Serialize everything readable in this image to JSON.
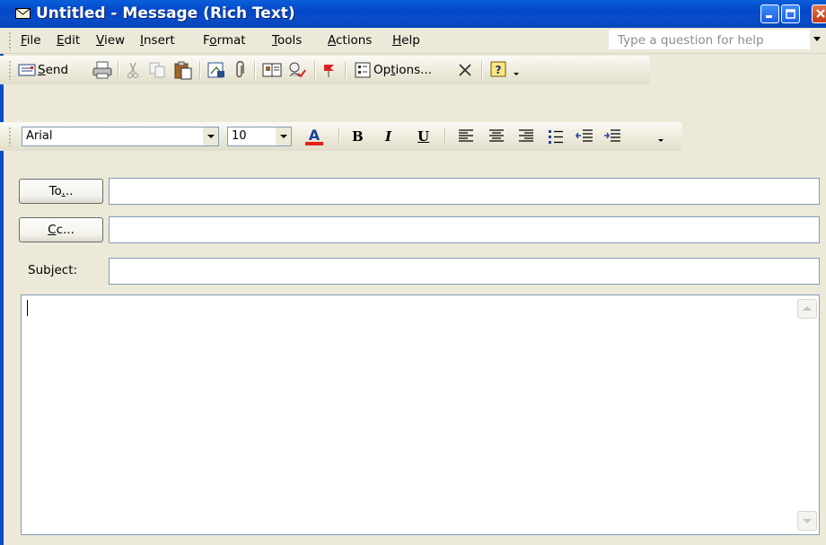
{
  "window": {
    "title": "Untitled - Message (Rich Text)",
    "title_bar_color": "#0A4CC8",
    "icons": [
      "envelope-icon",
      "minimize-icon",
      "maximize-icon",
      "close-icon"
    ]
  },
  "menu": {
    "items": [
      {
        "label": "File",
        "accel": "F",
        "rest": "ile"
      },
      {
        "label": "Edit",
        "accel": "E",
        "rest": "dit"
      },
      {
        "label": "View",
        "accel": "V",
        "rest": "iew"
      },
      {
        "label": "Insert",
        "accel": "I",
        "rest": "nsert"
      },
      {
        "label": "Format",
        "pre": "F",
        "accel": "o",
        "rest": "rmat"
      },
      {
        "label": "Tools",
        "accel": "T",
        "rest": "ools"
      },
      {
        "label": "Actions",
        "accel": "A",
        "rest": "ctions"
      },
      {
        "label": "Help",
        "accel": "H",
        "rest": "elp"
      }
    ],
    "help_placeholder": "Type a question for help"
  },
  "standard_toolbar": {
    "send_accel": "S",
    "send_rest": "end",
    "options_pre": "Op",
    "options_accel": "t",
    "options_rest": "ions...",
    "icons": [
      "print-icon",
      "cut-icon",
      "copy-icon",
      "paste-icon",
      "insert-file-icon",
      "attachment-icon",
      "address-book-icon",
      "check-names-icon",
      "flag-icon",
      "options-icon",
      "delete-icon",
      "help-icon"
    ]
  },
  "formatting_toolbar": {
    "font": "Arial",
    "size": "10",
    "font_color": "#E8201A",
    "bold": "B",
    "italic": "I",
    "underline": "U",
    "icons": [
      "align-left-icon",
      "center-icon",
      "align-right-icon",
      "bullets-icon",
      "decrease-indent-icon",
      "increase-indent-icon"
    ]
  },
  "fields": {
    "to_pre": "To",
    "to_accel": ".",
    "to_rest": "..",
    "cc_accel": "C",
    "cc_rest": "c...",
    "subject_pre": "Sub",
    "subject_accel": "j",
    "subject_rest": "ect:",
    "to_value": "",
    "cc_value": "",
    "subject_value": "",
    "body_value": ""
  }
}
